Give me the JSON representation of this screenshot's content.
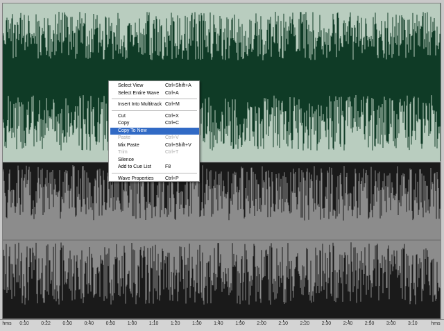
{
  "colors": {
    "upper_bg": "#0f3b26",
    "upper_wave": "#b9cdbf",
    "lower_bg": "#8c8c8c",
    "lower_wave": "#1a1a1a",
    "ruler_bg": "#d4d4d4",
    "menu_highlight": "#316ac5"
  },
  "context_menu": {
    "groups": [
      [
        {
          "label": "Select View",
          "shortcut": "Ctrl+Shift+A",
          "enabled": true,
          "highlighted": false
        },
        {
          "label": "Select Entire Wave",
          "shortcut": "Ctrl+A",
          "enabled": true,
          "highlighted": false
        }
      ],
      [
        {
          "label": "Insert Into Multitrack",
          "shortcut": "Ctrl+M",
          "enabled": true,
          "highlighted": false
        }
      ],
      [
        {
          "label": "Cut",
          "shortcut": "Ctrl+X",
          "enabled": true,
          "highlighted": false
        },
        {
          "label": "Copy",
          "shortcut": "Ctrl+C",
          "enabled": true,
          "highlighted": false
        },
        {
          "label": "Copy To New",
          "shortcut": "",
          "enabled": true,
          "highlighted": true
        },
        {
          "label": "Paste",
          "shortcut": "Ctrl+V",
          "enabled": false,
          "highlighted": false
        },
        {
          "label": "Mix Paste",
          "shortcut": "Ctrl+Shift+V",
          "enabled": true,
          "highlighted": false
        },
        {
          "label": "Trim",
          "shortcut": "Ctrl+T",
          "enabled": false,
          "highlighted": false
        },
        {
          "label": "Silence",
          "shortcut": "",
          "enabled": true,
          "highlighted": false
        },
        {
          "label": "Add to Cue List",
          "shortcut": "F8",
          "enabled": true,
          "highlighted": false
        }
      ],
      [
        {
          "label": "Wave Properties",
          "shortcut": "Ctrl+P",
          "enabled": true,
          "highlighted": false
        }
      ]
    ]
  },
  "ruler": {
    "unit_left": "hms",
    "unit_right": "hms",
    "ticks": [
      "0:10",
      "0:22",
      "0:30",
      "0:40",
      "0:50",
      "1:00",
      "1:10",
      "1:20",
      "1:30",
      "1:40",
      "1:50",
      "2:00",
      "2:10",
      "2:20",
      "2:30",
      "2:40",
      "2:50",
      "3:00",
      "3:10"
    ]
  }
}
